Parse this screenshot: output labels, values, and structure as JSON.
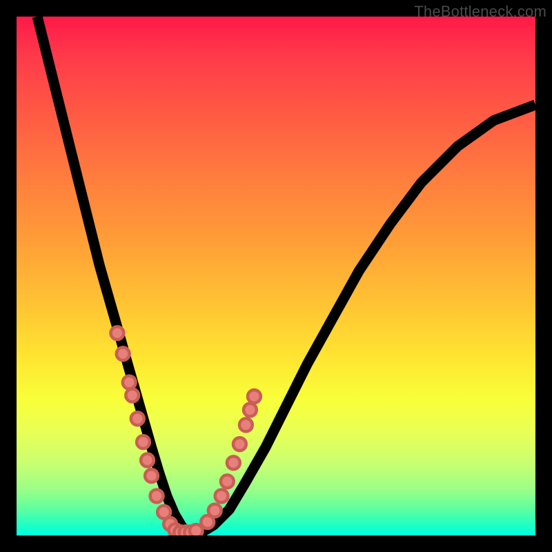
{
  "watermark": "TheBottleneck.com",
  "chart_data": {
    "type": "line",
    "title": "",
    "xlabel": "",
    "ylabel": "",
    "xlim": [
      0,
      100
    ],
    "ylim": [
      0,
      100
    ],
    "series": [
      {
        "name": "bottleneck-curve",
        "x": [
          4,
          6,
          8,
          10,
          12,
          14,
          16,
          18,
          20,
          22,
          24,
          26,
          27.5,
          29,
          30.5,
          32,
          33.5,
          35.5,
          38,
          41,
          44,
          48,
          52,
          56,
          61,
          66,
          72,
          78,
          85,
          92,
          100
        ],
        "y": [
          100,
          92,
          84,
          76,
          68,
          60,
          52,
          45,
          38,
          31,
          24,
          17,
          12,
          7.5,
          4,
          1.5,
          0.5,
          0.5,
          2,
          5,
          10,
          17,
          25,
          33,
          42,
          51,
          60,
          68,
          75,
          80,
          83
        ]
      }
    ],
    "markers": {
      "name": "highlighted-points",
      "shape": "circle",
      "color": "#e77f7a",
      "points_xy": [
        [
          19.4,
          39
        ],
        [
          20.5,
          35
        ],
        [
          21.7,
          29.5
        ],
        [
          22.3,
          27
        ],
        [
          23.3,
          22.5
        ],
        [
          24.4,
          18
        ],
        [
          25.2,
          14.5
        ],
        [
          26.0,
          11.5
        ],
        [
          27.0,
          7.6
        ],
        [
          28.4,
          4.5
        ],
        [
          29.6,
          2.2
        ],
        [
          30.6,
          1.0
        ],
        [
          31.6,
          0.6
        ],
        [
          32.6,
          0.6
        ],
        [
          33.6,
          0.6
        ],
        [
          34.6,
          0.9
        ],
        [
          36.8,
          2.6
        ],
        [
          38.2,
          4.8
        ],
        [
          39.5,
          7.6
        ],
        [
          40.6,
          10.4
        ],
        [
          41.8,
          14
        ],
        [
          43.0,
          17.6
        ],
        [
          44.2,
          21.3
        ],
        [
          45.0,
          24.2
        ],
        [
          45.8,
          26.8
        ]
      ]
    },
    "background_gradient": {
      "top_color": "#ff1a48",
      "bottom_color": "#00ffe0"
    }
  }
}
